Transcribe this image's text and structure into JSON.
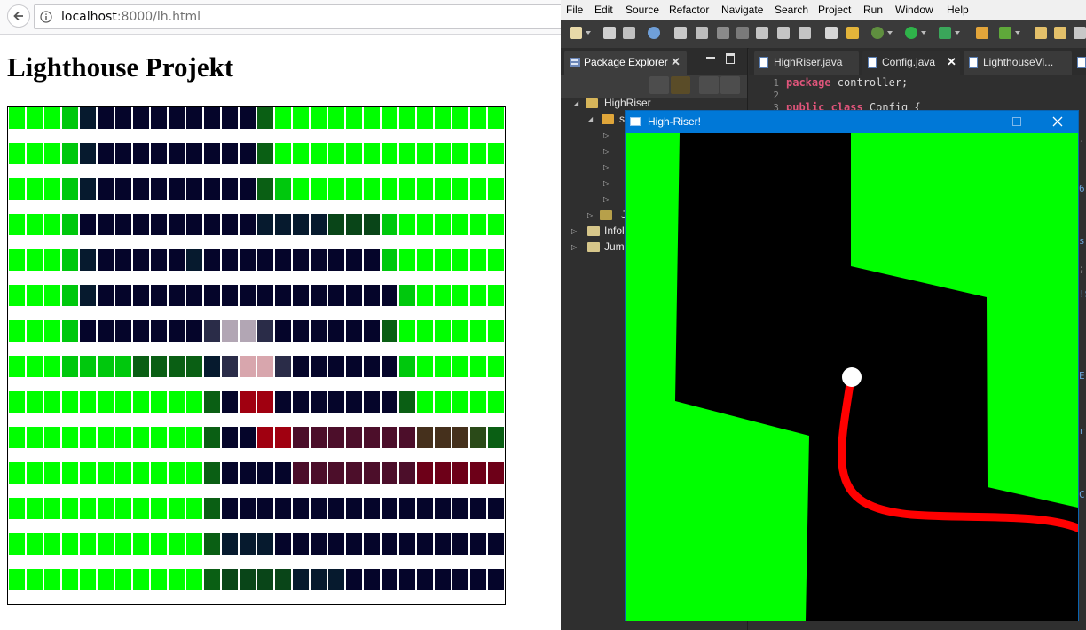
{
  "browser": {
    "url_host": "localhost",
    "url_rest": ":8000/lh.html",
    "page_title": "Lighthouse Projekt",
    "grid": {
      "cols": 28,
      "rows": 14,
      "palette": {
        "G": "#00ff00",
        "g": "#00c80d",
        "d": "#0a5f14",
        "e": "#094518",
        "b": "#05052a",
        "t": "#061a2e",
        "v": "#2a2c48",
        "p": "#b2a6b4",
        "q": "#d8a6ad",
        "r": "#a00010",
        "m": "#4c0e2a",
        "n": "#45301c",
        "o": "#2a4a18",
        "u": "#6d0018"
      },
      "rows_data": [
        "GGGgtbbbbbbbbbdGGGGGGGGGGGGG",
        "GGGgtbbbbbbbbbdGGGGGGGGGGGGG",
        "GGGgtbbbbbbbbbdgGGGGGGGGGGGG",
        "GGGgbbbbbbbbbbtttteeegGGGGGG",
        "GGGgtbbbbbtbbbbbbbbbbgGGGGGG",
        "GGGgtbbbbbbbbbbbbbbbbbgGGGGG",
        "GGGgbbbbbbbvppvbbbbbbdGGGGGG",
        "GGGggggddddtvqqvbbbbbbgGGGGG",
        "GGGGGGGGGGGdbrrbbbbbbbdGGGGG",
        "GGGGGGGGGGGdbbrrmmmmmmmnnnod",
        "GGGGGGGGGGGdbbbbmmmmmmmuuuuu",
        "GGGGGGGGGGGdbbbbbbbbbbbbbbbb",
        "GGGGGGGGGGGdtttbbbbbbbbbbbbb",
        "GGGGGGGGGGGdeeeetttbbbbbbbbb"
      ]
    }
  },
  "eclipse": {
    "menu": [
      "File",
      "Edit",
      "Source",
      "Refactor",
      "Navigate",
      "Search",
      "Project",
      "Run",
      "Window",
      "Help"
    ],
    "package_explorer": {
      "tab_label": "Package Explorer",
      "tree": [
        {
          "label": "HighRiser",
          "arrow": "◢"
        },
        {
          "label": "s",
          "arrow": "◢"
        },
        {
          "label": "",
          "arrow": "▷"
        },
        {
          "label": "",
          "arrow": "▷"
        },
        {
          "label": "",
          "arrow": "▷"
        },
        {
          "label": "",
          "arrow": "▷"
        },
        {
          "label": "",
          "arrow": "▷"
        },
        {
          "label": "J",
          "arrow": "▷"
        },
        {
          "label": "Infol",
          "arrow": "▷"
        },
        {
          "label": "Jum",
          "arrow": "▷"
        }
      ]
    },
    "editor_tabs": [
      {
        "label": "HighRiser.java",
        "active": false
      },
      {
        "label": "Config.java",
        "active": true
      },
      {
        "label": "LighthouseVi...",
        "active": false
      }
    ],
    "line_numbers": [
      "1",
      "2",
      "3"
    ],
    "code": {
      "line1_kw": "package",
      "line1_rest": " controller;",
      "line3_kw": "public class",
      "line3_rest": " Config {"
    },
    "edge_glyphs": [
      ".",
      "6",
      "s",
      ";",
      "!S",
      "E",
      "r",
      "C"
    ]
  },
  "game_window": {
    "title": "High-Riser!",
    "colors": {
      "wall": "#00ff00",
      "background": "#000000",
      "trail": "#ff0000",
      "ball": "#ffffff",
      "titlebar": "#0078d7"
    }
  }
}
